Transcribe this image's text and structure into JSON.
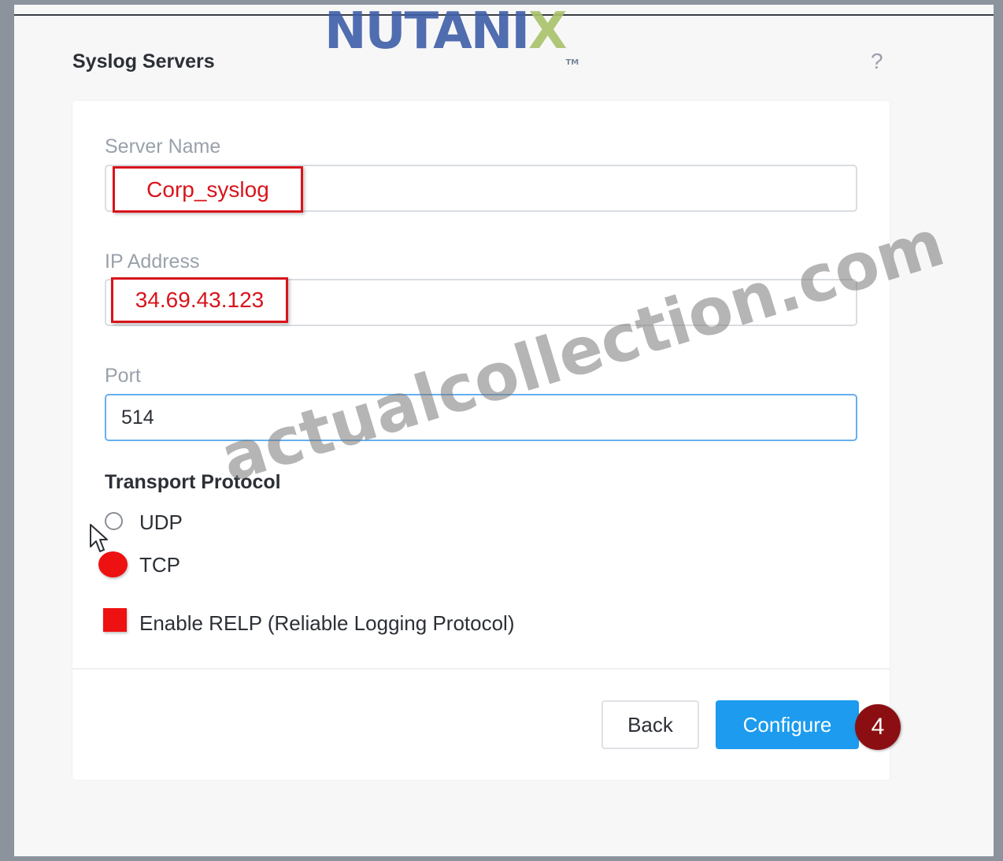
{
  "branding": {
    "logo_main": "NUTANI",
    "logo_x": "X",
    "logo_tm": "TM"
  },
  "dialog": {
    "title": "Syslog Servers",
    "help_glyph": "?"
  },
  "form": {
    "server_name": {
      "label": "Server Name",
      "value": "Corp_syslog"
    },
    "ip_address": {
      "label": "IP Address",
      "value": "34.69.43.123"
    },
    "port": {
      "label": "Port",
      "value": "514"
    },
    "transport_protocol": {
      "label": "Transport Protocol",
      "options": [
        {
          "label": "UDP",
          "selected": false
        },
        {
          "label": "TCP",
          "selected": true
        }
      ]
    },
    "relp": {
      "label": "Enable RELP (Reliable Logging Protocol)",
      "checked": true
    }
  },
  "footer": {
    "back_label": "Back",
    "configure_label": "Configure",
    "step_number": "4"
  },
  "watermark": "actualcollection.com",
  "colors": {
    "highlight_red": "#d8141c",
    "primary_blue": "#1c9bef",
    "badge_maroon": "#8b0f12",
    "logo_blue": "#3f5fa8",
    "logo_green": "#a9c26b"
  },
  "icons": {
    "help": "question-mark-icon",
    "cursor": "mouse-pointer-icon"
  }
}
